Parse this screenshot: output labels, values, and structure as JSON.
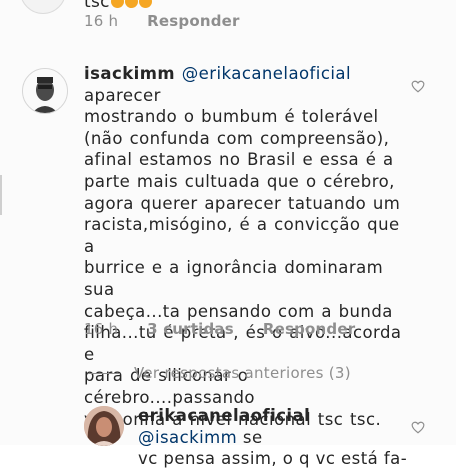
{
  "top_comment": {
    "text": "tsc",
    "time": "16 h",
    "reply_label": "Responder"
  },
  "main_comment": {
    "username": "isackimm",
    "mention": "@erikacanelaoficial",
    "text": " aparecer\nmostrando o bumbum é tolerável\n(não confunda com  compreensão),\nafinal estamos no Brasil e essa é a\nparte mais cultuada que o cérebro,\nagora querer aparecer tatuando um\nracista,misógino, é a convicção que a\nburrice e a ignorância dominaram sua\ncabeça...ta pensando com a bunda\nfilha...tu é preta , és o alvo...acorda e\npara de siliconar o cérebro....passando\nvergonha a nivel nacional tsc tsc.",
    "time": "16 h",
    "likes": "3 curtidas",
    "reply_label": "Responder"
  },
  "view_previous": "Ver respostas anteriores (3)",
  "reply_comment": {
    "username": "erikacanelaoficial",
    "mention": "@isackimm",
    "text": " se\nvc pensa assim, o q vc está fa-"
  },
  "icons": {
    "like": "heart-outline-icon"
  }
}
